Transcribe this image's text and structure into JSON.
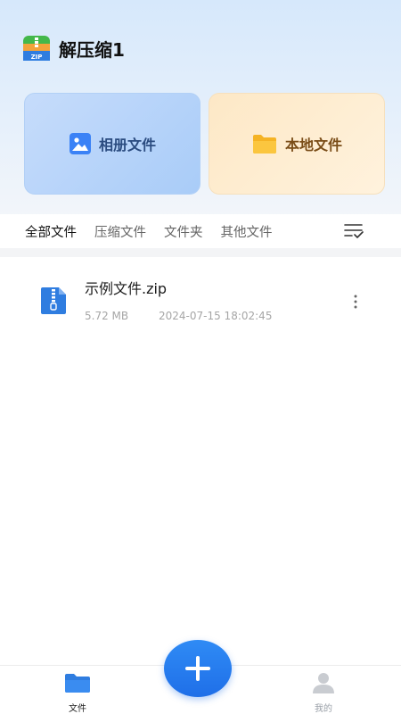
{
  "app": {
    "title": "解压缩1",
    "logo_icon": "zip-app-logo-icon"
  },
  "cards": {
    "album": {
      "label": "相册文件",
      "icon": "image-icon",
      "color": "#3b82f6"
    },
    "local": {
      "label": "本地文件",
      "icon": "folder-icon",
      "color": "#f5b324"
    }
  },
  "tabs": [
    {
      "label": "全部文件",
      "active": true
    },
    {
      "label": "压缩文件",
      "active": false
    },
    {
      "label": "文件夹",
      "active": false
    },
    {
      "label": "其他文件",
      "active": false
    }
  ],
  "sort_icon": "sort-list-check-icon",
  "files": [
    {
      "name": "示例文件.zip",
      "size": "5.72 MB",
      "date": "2024-07-15 18:02:45",
      "icon": "zip-file-icon"
    }
  ],
  "bottom_nav": {
    "files": {
      "label": "文件",
      "icon": "folder-icon",
      "active": true
    },
    "mine": {
      "label": "我的",
      "icon": "user-icon",
      "active": false
    }
  },
  "fab": {
    "icon": "plus-icon",
    "color": "#2f8bf5"
  }
}
